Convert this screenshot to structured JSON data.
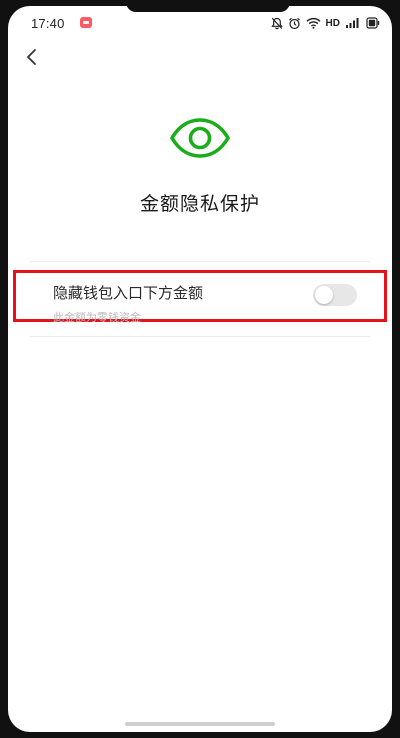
{
  "status_bar": {
    "time": "17:40",
    "network": "HD"
  },
  "nav": {
    "back_icon": "chevron-left-icon"
  },
  "page": {
    "icon": "eye-icon",
    "icon_color": "#1aad19",
    "title": "金额隐私保护"
  },
  "setting": {
    "label": "隐藏钱包入口下方金额",
    "hint": "此金额为零钱资金",
    "toggle_on": false,
    "highlight_color": "#e8121b"
  }
}
